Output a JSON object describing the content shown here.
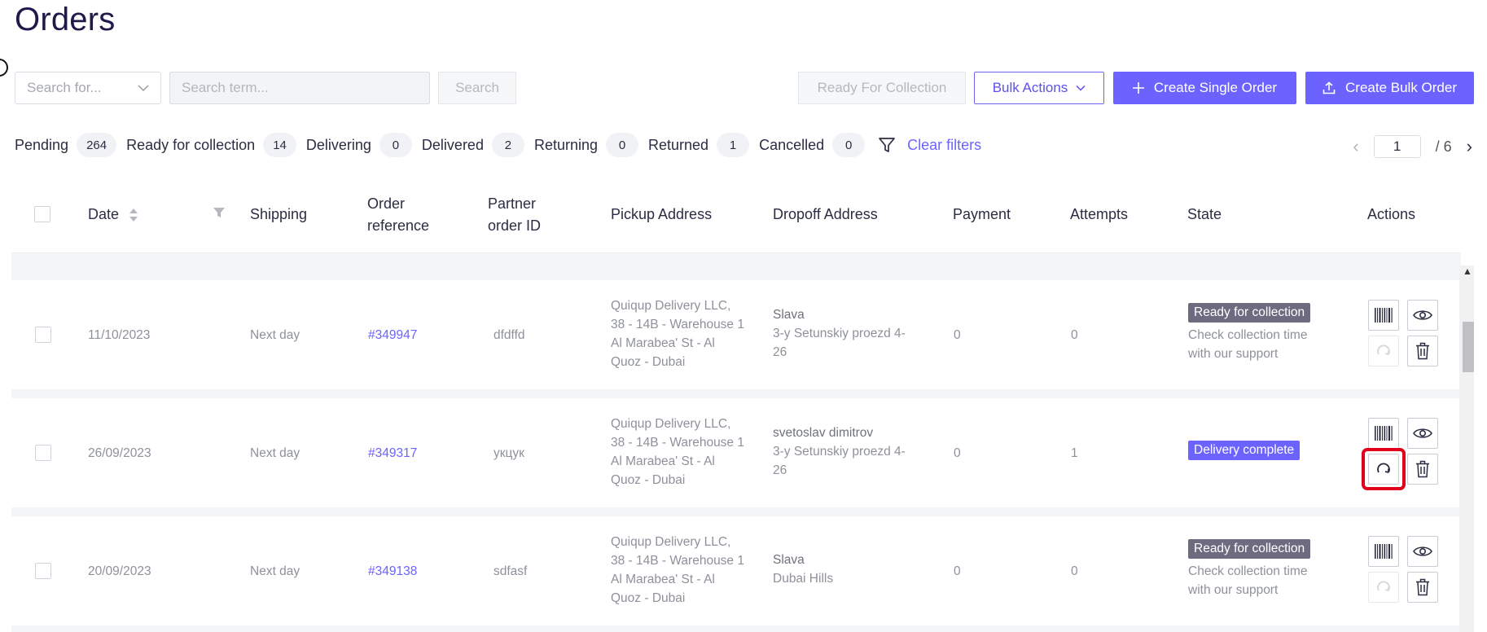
{
  "page": {
    "title": "Orders"
  },
  "search": {
    "field_placeholder": "Search for...",
    "term_placeholder": "Search term...",
    "button": "Search"
  },
  "toolbar": {
    "ready_for_collection": "Ready For Collection",
    "bulk_actions": "Bulk Actions",
    "create_single": "Create Single Order",
    "create_bulk": "Create Bulk Order"
  },
  "filters": [
    {
      "label": "Pending",
      "count": "264"
    },
    {
      "label": "Ready for collection",
      "count": "14"
    },
    {
      "label": "Delivering",
      "count": "0"
    },
    {
      "label": "Delivered",
      "count": "2"
    },
    {
      "label": "Returning",
      "count": "0"
    },
    {
      "label": "Returned",
      "count": "1"
    },
    {
      "label": "Cancelled",
      "count": "0"
    }
  ],
  "clear_filters": "Clear filters",
  "pagination": {
    "current": "1",
    "total": "/ 6"
  },
  "columns": {
    "date": "Date",
    "shipping": "Shipping",
    "order_ref_1": "Order",
    "order_ref_2": "reference",
    "partner_1": "Partner",
    "partner_2": "order ID",
    "pickup": "Pickup Address",
    "dropoff": "Dropoff Address",
    "payment": "Payment",
    "attempts": "Attempts",
    "state": "State",
    "actions": "Actions"
  },
  "rows": [
    {
      "date": "11/10/2023",
      "shipping": "Next day",
      "ref": "#349947",
      "partner": "dfdffd",
      "pickup": [
        "Quiqup Delivery LLC,",
        "38 - 14B - Warehouse 1",
        "Al Marabea' St - Al",
        "Quoz - Dubai"
      ],
      "dropoff_name": "Slava",
      "dropoff": [
        "3-y Setunskiy proezd 4-",
        "26"
      ],
      "payment": "0",
      "attempts": "0",
      "state": "Ready for collection",
      "state_note": [
        "Check collection time",
        "with our support"
      ]
    },
    {
      "date": "26/09/2023",
      "shipping": "Next day",
      "ref": "#349317",
      "partner": "укцук",
      "pickup": [
        "Quiqup Delivery LLC,",
        "38 - 14B - Warehouse 1",
        "Al Marabea' St - Al",
        "Quoz - Dubai"
      ],
      "dropoff_name": "svetoslav dimitrov",
      "dropoff": [
        "3-y Setunskiy proezd 4-",
        "26"
      ],
      "payment": "0",
      "attempts": "1",
      "state": "Delivery complete",
      "state_note": []
    },
    {
      "date": "20/09/2023",
      "shipping": "Next day",
      "ref": "#349138",
      "partner": "sdfasf",
      "pickup": [
        "Quiqup Delivery LLC,",
        "38 - 14B - Warehouse 1",
        "Al Marabea' St - Al",
        "Quoz - Dubai"
      ],
      "dropoff_name": "Slava",
      "dropoff": [
        "Dubai Hills"
      ],
      "payment": "0",
      "attempts": "0",
      "state": "Ready for collection",
      "state_note": [
        "Check collection time",
        "with our support"
      ]
    }
  ],
  "colors": {
    "accent": "#6c63ff",
    "badge_grey": "#6e6a80",
    "highlight": "#e0001b"
  },
  "icons": [
    "chevron-down-icon",
    "plus-icon",
    "upload-icon",
    "filter-funnel-icon",
    "sort-icon",
    "barcode-icon",
    "eye-icon",
    "refresh-icon",
    "trash-icon",
    "chevron-left-icon",
    "chevron-right-icon"
  ]
}
